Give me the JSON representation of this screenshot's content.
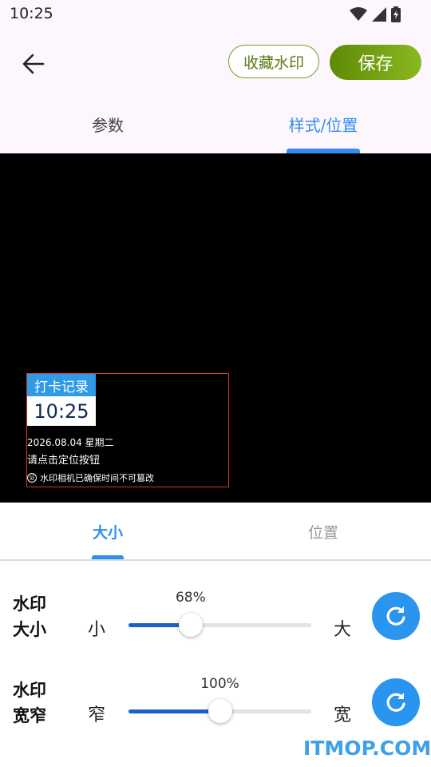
{
  "status": {
    "time": "10:25",
    "icons": [
      "wifi-icon",
      "signal-icon",
      "battery-icon"
    ]
  },
  "header": {
    "favorite_label": "收藏水印",
    "save_label": "保存",
    "back_icon": "arrow-left-icon"
  },
  "tabs": [
    {
      "label": "参数",
      "active": false
    },
    {
      "label": "样式/位置",
      "active": true
    }
  ],
  "watermark": {
    "title": "打卡记录",
    "time": "10:25",
    "date": "2026.08.04 星期二",
    "location_hint": "请点击定位按钮",
    "verify_badge": "证",
    "verify_text": "水印相机已确保时间不可篡改"
  },
  "sub_tabs": [
    {
      "label": "大小",
      "active": true
    },
    {
      "label": "位置",
      "active": false
    }
  ],
  "settings": {
    "size": {
      "label_line1": "水印",
      "label_line2": "大小",
      "min_label": "小",
      "max_label": "大",
      "value_text": "68%",
      "fraction": 0.34
    },
    "width": {
      "label_line1": "水印",
      "label_line2": "宽窄",
      "min_label": "窄",
      "max_label": "宽",
      "value_text": "100%",
      "fraction": 0.5
    }
  },
  "colors": {
    "accent": "#2f8ff0",
    "save_green": "#6f9c10",
    "slider_fill": "#1e5fcf",
    "reset_blue": "#2a95ee"
  },
  "site_watermark": "ITMOP.COM"
}
